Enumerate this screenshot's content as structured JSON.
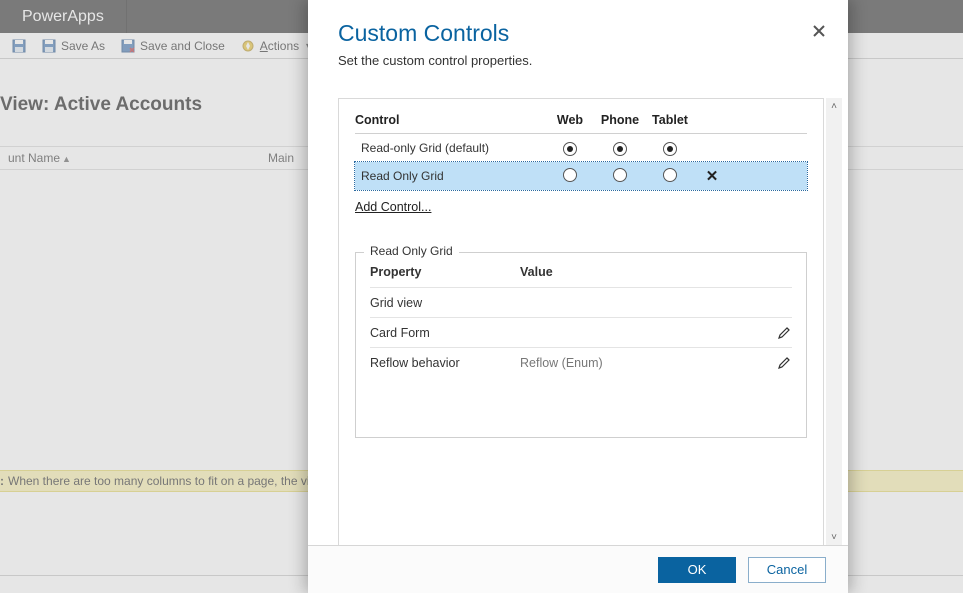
{
  "app": {
    "name": "PowerApps",
    "toolbar": {
      "save_icon_title": "Save",
      "save_as": "Save As",
      "save_close": "Save and Close",
      "actions": "Actions"
    },
    "view_title": "View: Active Accounts",
    "grid_headers": {
      "col1": "unt Name",
      "col2": "Main"
    },
    "note_prefix": ":",
    "note_text": "When there are too many columns to fit on a page, the view"
  },
  "dialog": {
    "title": "Custom Controls",
    "subtitle": "Set the custom control properties.",
    "controls": {
      "header": {
        "control": "Control",
        "web": "Web",
        "phone": "Phone",
        "tablet": "Tablet"
      },
      "rows": [
        {
          "name": "Read-only Grid (default)",
          "web": true,
          "phone": true,
          "tablet": true,
          "removable": false,
          "selected": false
        },
        {
          "name": "Read Only Grid",
          "web": false,
          "phone": false,
          "tablet": false,
          "removable": true,
          "selected": true
        }
      ],
      "add_link": "Add Control..."
    },
    "properties": {
      "legend": "Read Only Grid",
      "header": {
        "property": "Property",
        "value": "Value"
      },
      "rows": [
        {
          "name": "Grid view",
          "value": "",
          "editable": false
        },
        {
          "name": "Card Form",
          "value": "",
          "editable": true
        },
        {
          "name": "Reflow behavior",
          "value": "Reflow (Enum)",
          "editable": true
        }
      ]
    },
    "buttons": {
      "ok": "OK",
      "cancel": "Cancel"
    }
  }
}
